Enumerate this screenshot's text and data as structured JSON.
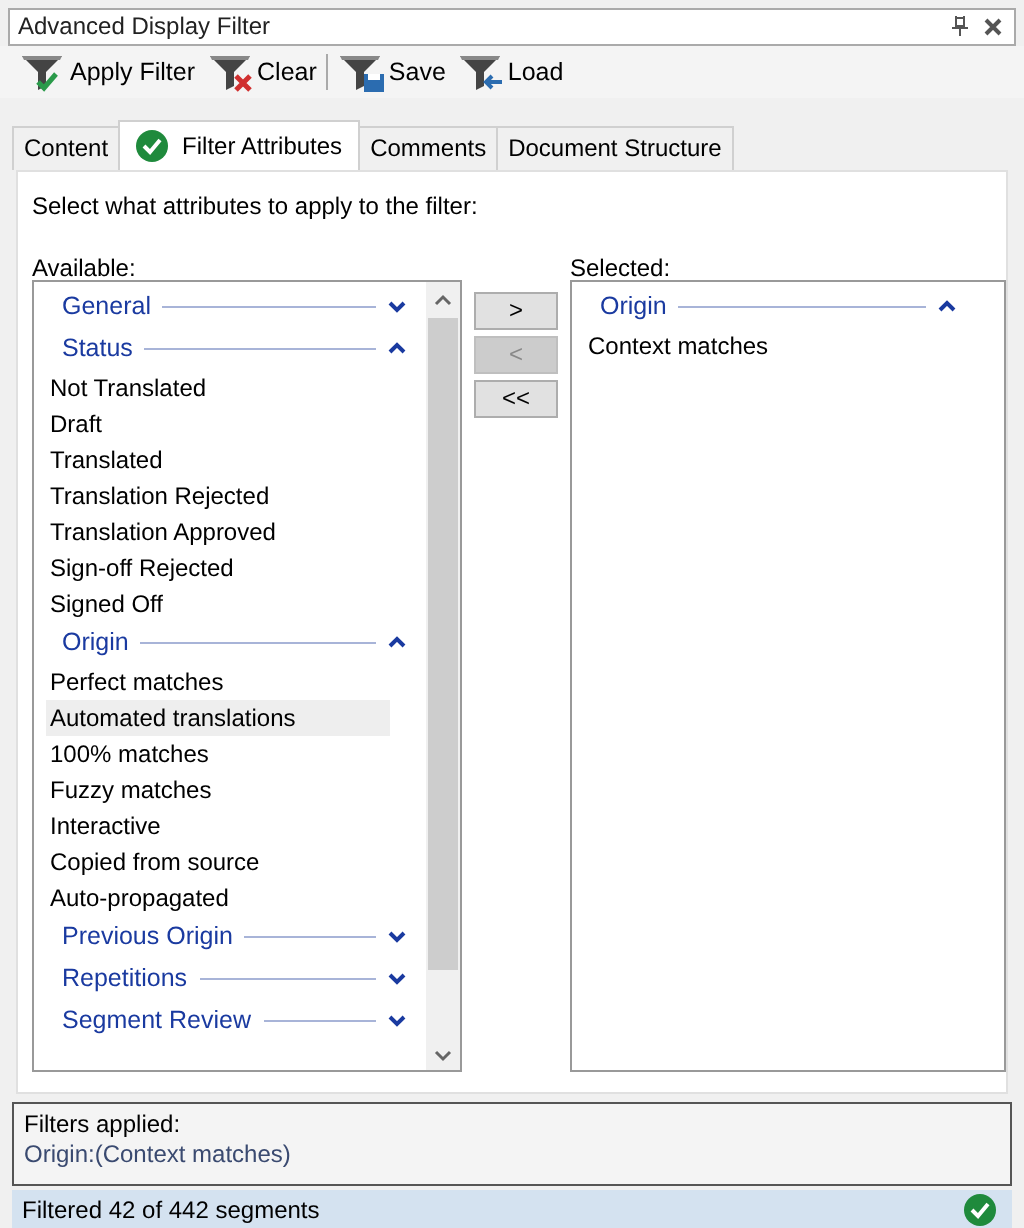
{
  "window": {
    "title": "Advanced Display Filter"
  },
  "toolbar": [
    {
      "kind": "apply",
      "label": "Apply Filter"
    },
    {
      "kind": "clear",
      "label": "Clear"
    },
    {
      "kind": "save",
      "label": "Save"
    },
    {
      "kind": "load",
      "label": "Load"
    }
  ],
  "tabs": [
    {
      "label": "Content",
      "selected": false,
      "checked": false
    },
    {
      "label": "Filter Attributes",
      "selected": true,
      "checked": true
    },
    {
      "label": "Comments",
      "selected": false,
      "checked": false
    },
    {
      "label": "Document Structure",
      "selected": false,
      "checked": false
    }
  ],
  "instruction": "Select what attributes to apply to the filter:",
  "available": {
    "label": "Available:",
    "groups": [
      {
        "name": "General",
        "expanded": false
      },
      {
        "name": "Status",
        "expanded": true,
        "items": [
          {
            "label": "Not Translated",
            "selected": false
          },
          {
            "label": "Draft",
            "selected": false
          },
          {
            "label": "Translated",
            "selected": false
          },
          {
            "label": "Translation Rejected",
            "selected": false
          },
          {
            "label": "Translation Approved",
            "selected": false
          },
          {
            "label": "Sign-off Rejected",
            "selected": false
          },
          {
            "label": "Signed Off",
            "selected": false
          }
        ]
      },
      {
        "name": "Origin",
        "expanded": true,
        "items": [
          {
            "label": "Perfect matches",
            "selected": false
          },
          {
            "label": "Automated translations",
            "selected": true
          },
          {
            "label": "100% matches",
            "selected": false
          },
          {
            "label": "Fuzzy matches",
            "selected": false
          },
          {
            "label": "Interactive",
            "selected": false
          },
          {
            "label": "Copied from source",
            "selected": false
          },
          {
            "label": "Auto-propagated",
            "selected": false
          }
        ]
      },
      {
        "name": "Previous Origin",
        "expanded": false
      },
      {
        "name": "Repetitions",
        "expanded": false
      },
      {
        "name": "Segment Review",
        "expanded": false
      }
    ]
  },
  "move_buttons": [
    {
      "label": ">",
      "disabled": false
    },
    {
      "label": "<",
      "disabled": true
    },
    {
      "label": "<<",
      "disabled": false
    }
  ],
  "selected_list": {
    "label": "Selected:",
    "groups": [
      {
        "name": "Origin",
        "expanded": true,
        "items": [
          {
            "label": "Context matches",
            "selected": false
          }
        ]
      }
    ]
  },
  "filters_applied": {
    "label": "Filters applied:",
    "value": "Origin:(Context matches)"
  },
  "status_bar": {
    "text": "Filtered 42 of 442 segments"
  }
}
